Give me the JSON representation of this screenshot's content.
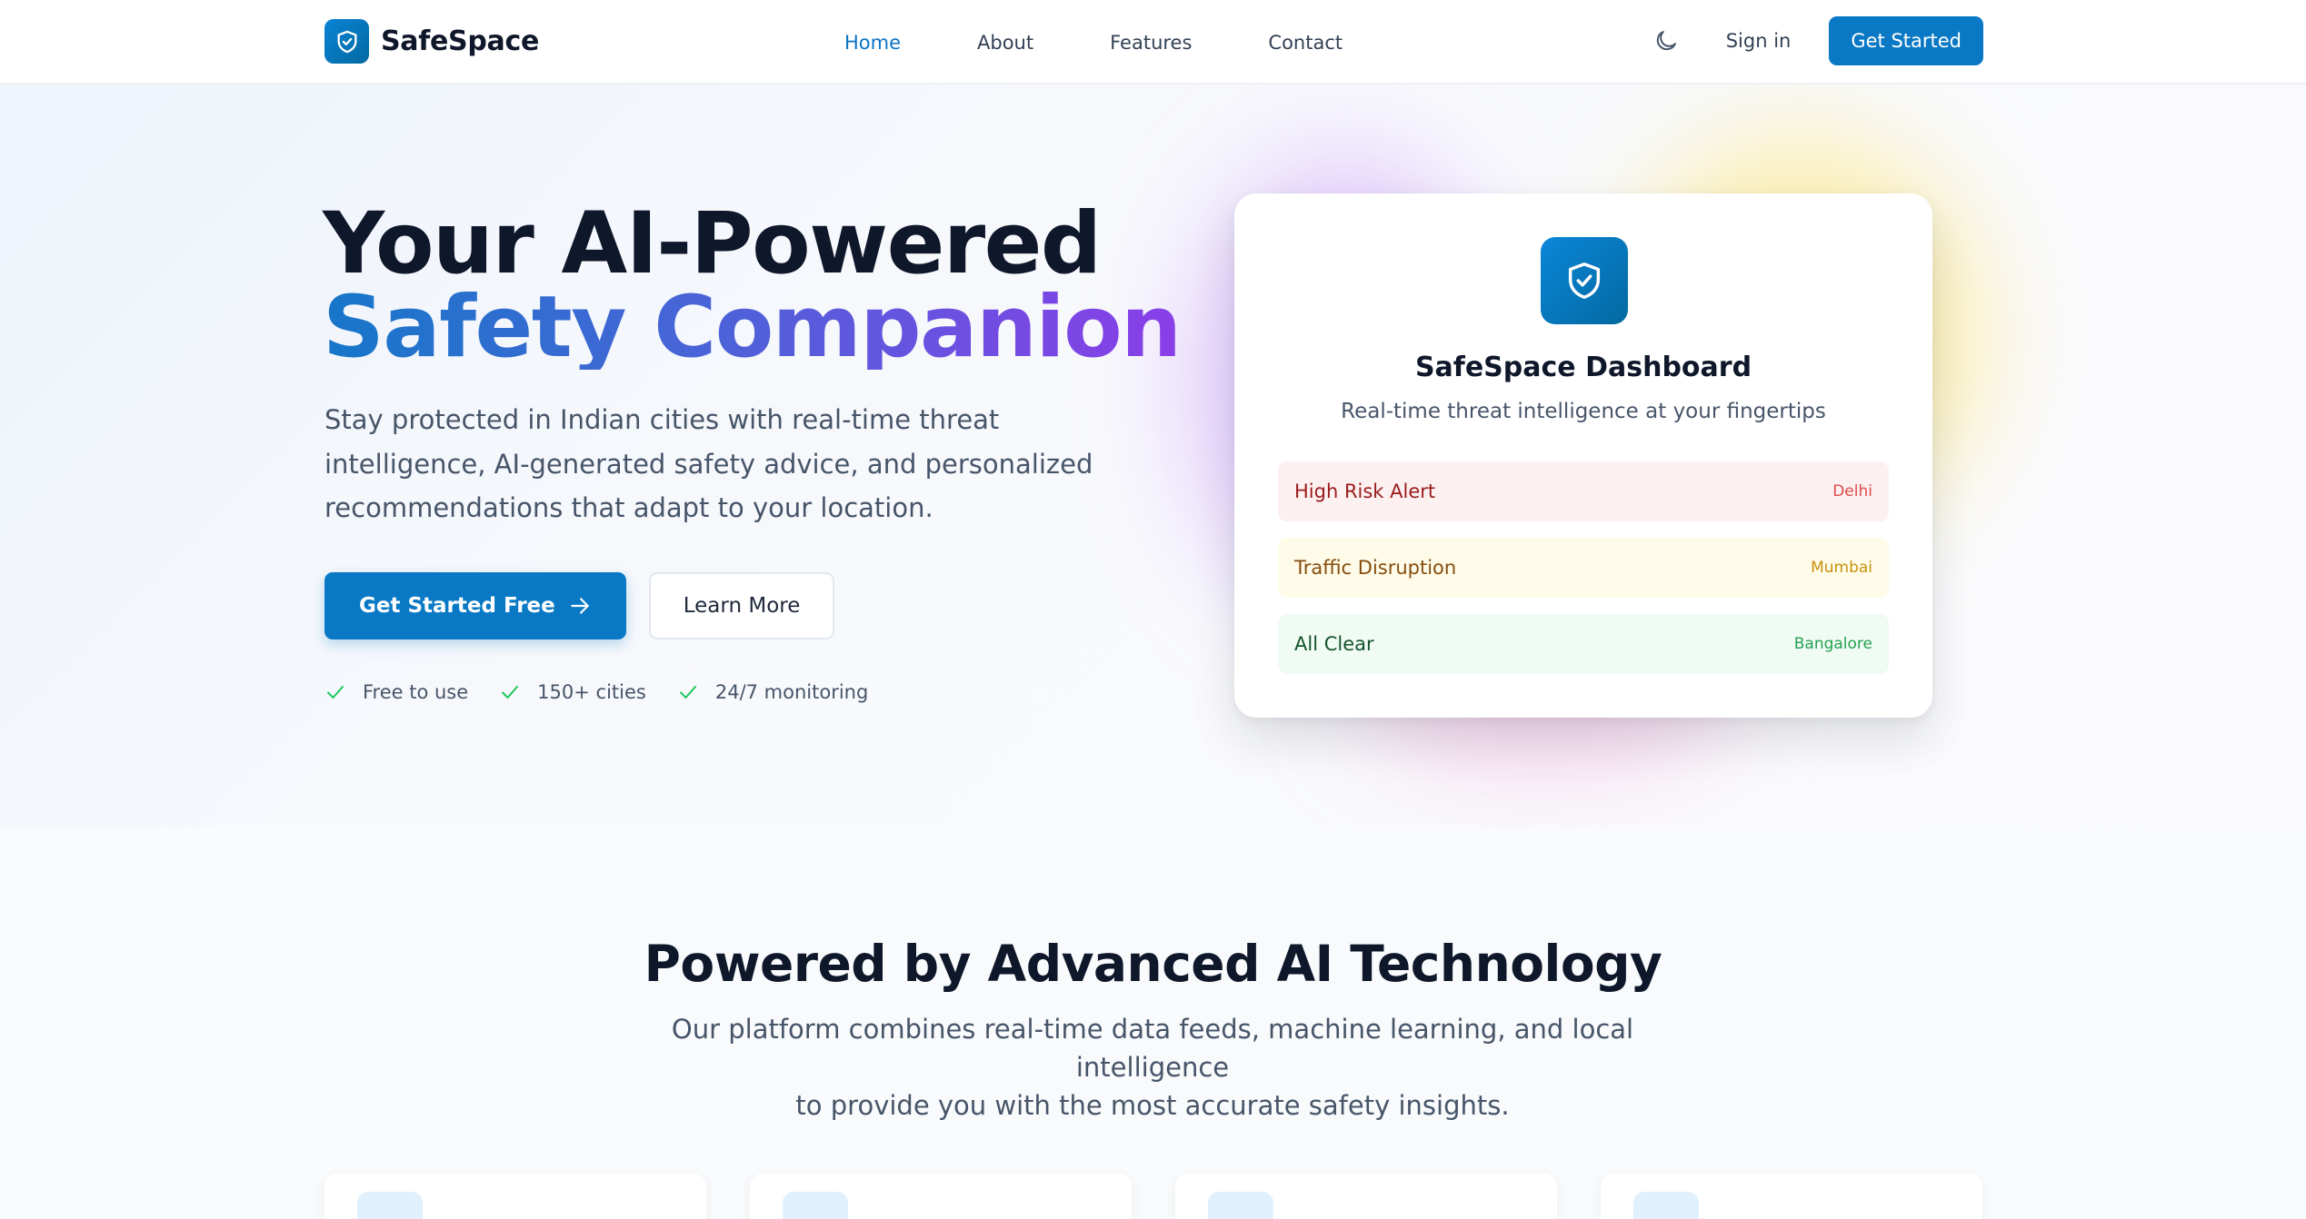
{
  "brand": {
    "name": "SafeSpace"
  },
  "nav": {
    "links": [
      {
        "label": "Home",
        "active": true
      },
      {
        "label": "About",
        "active": false
      },
      {
        "label": "Features",
        "active": false
      },
      {
        "label": "Contact",
        "active": false
      }
    ],
    "signin": "Sign in",
    "get_started": "Get Started"
  },
  "hero": {
    "title_line1": "Your AI-Powered",
    "title_line2": "Safety Companion",
    "description": "Stay protected in Indian cities with real-time threat intelligence, AI-generated safety advice, and personalized recommendations that adapt to your location.",
    "primary_button": "Get Started Free",
    "secondary_button": "Learn More",
    "checks": [
      "Free to use",
      "150+ cities",
      "24/7 monitoring"
    ]
  },
  "dashboard": {
    "title": "SafeSpace Dashboard",
    "subtitle": "Real-time threat intelligence at your fingertips",
    "alerts": [
      {
        "label": "High Risk Alert",
        "city": "Delhi",
        "level": "red"
      },
      {
        "label": "Traffic Disruption",
        "city": "Mumbai",
        "level": "yellow"
      },
      {
        "label": "All Clear",
        "city": "Bangalore",
        "level": "green"
      }
    ]
  },
  "features": {
    "title": "Powered by Advanced AI Technology",
    "description_line1": "Our platform combines real-time data feeds, machine learning, and local intelligence",
    "description_line2": "to provide you with the most accurate safety insights."
  },
  "colors": {
    "primary": "#0a79c5",
    "gradient_start": "#1677c9",
    "gradient_end": "#8a3ee8",
    "check_green": "#22c55e"
  },
  "icons": {
    "brand": "shield-check-icon",
    "theme": "moon-icon",
    "arrow": "arrow-right-icon",
    "check": "check-icon"
  }
}
